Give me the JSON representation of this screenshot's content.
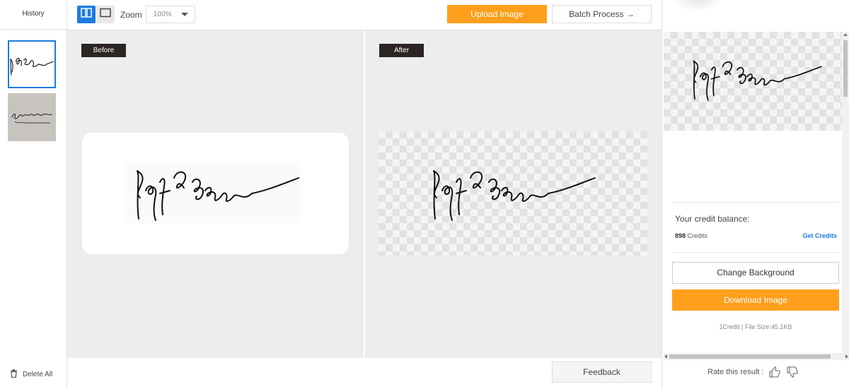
{
  "history": {
    "title": "History",
    "delete_all_label": "Delete All",
    "items": [
      {
        "label": "signature thumbnail 1",
        "selected": true
      },
      {
        "label": "signature thumbnail 2",
        "selected": false
      }
    ]
  },
  "toolbar": {
    "zoom_label": "Zoom",
    "zoom_value": "100%",
    "upload_label": "Upload Image",
    "batch_label": "Batch Process →"
  },
  "panels": {
    "before_label": "Before",
    "after_label": "After"
  },
  "footer": {
    "feedback_label": "Feedback"
  },
  "sidebar": {
    "credit_title": "Your credit balance:",
    "credits_count": "898",
    "credits_unit": "Credits",
    "get_credits_label": "Get Credits",
    "change_bg_label": "Change Background",
    "download_label": "Download Image",
    "file_info": "1Credit | File Size:45.1KB",
    "rate_label": "Rate this result :"
  },
  "colors": {
    "accent_blue": "#1a7ce0",
    "accent_orange": "#ff9f1c",
    "tag_dark": "#2b2523",
    "panel_bg": "#ededed"
  },
  "icons": [
    "split-view-icon",
    "single-view-icon",
    "chevron-down-icon",
    "trash-icon",
    "thumbs-up-icon",
    "thumbs-down-icon"
  ]
}
